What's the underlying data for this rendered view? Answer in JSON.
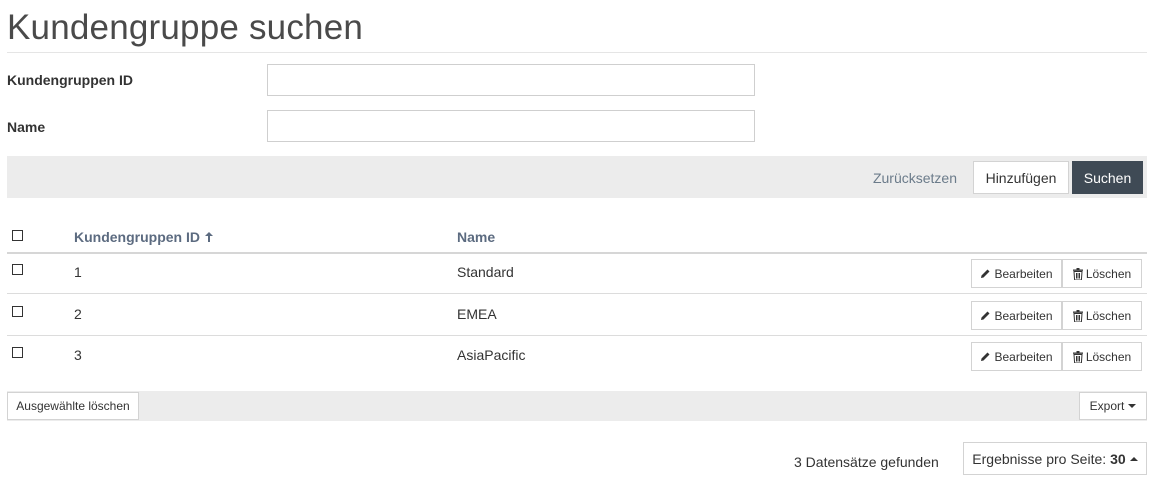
{
  "page": {
    "title": "Kundengruppe suchen"
  },
  "form": {
    "id_label": "Kundengruppen ID",
    "id_value": "",
    "name_label": "Name",
    "name_value": ""
  },
  "actions": {
    "reset": "Zurücksetzen",
    "add": "Hinzufügen",
    "search": "Suchen"
  },
  "table": {
    "headers": {
      "id": "Kundengruppen ID",
      "name": "Name"
    },
    "sort": "ascending",
    "rows": [
      {
        "id": "1",
        "name": "Standard"
      },
      {
        "id": "2",
        "name": "EMEA"
      },
      {
        "id": "3",
        "name": "AsiaPacific"
      }
    ],
    "row_actions": {
      "edit": "Bearbeiten",
      "delete": "Löschen"
    }
  },
  "footer": {
    "delete_selected": "Ausgewählte löschen",
    "export": "Export",
    "records_found": "3 Datensätze gefunden",
    "per_page_label": "Ergebnisse pro Seite:",
    "per_page_value": "30"
  },
  "colors": {
    "primary_button": "#3f4a55",
    "toolbar_bg": "#ececec",
    "header_text": "#5c6b80"
  }
}
